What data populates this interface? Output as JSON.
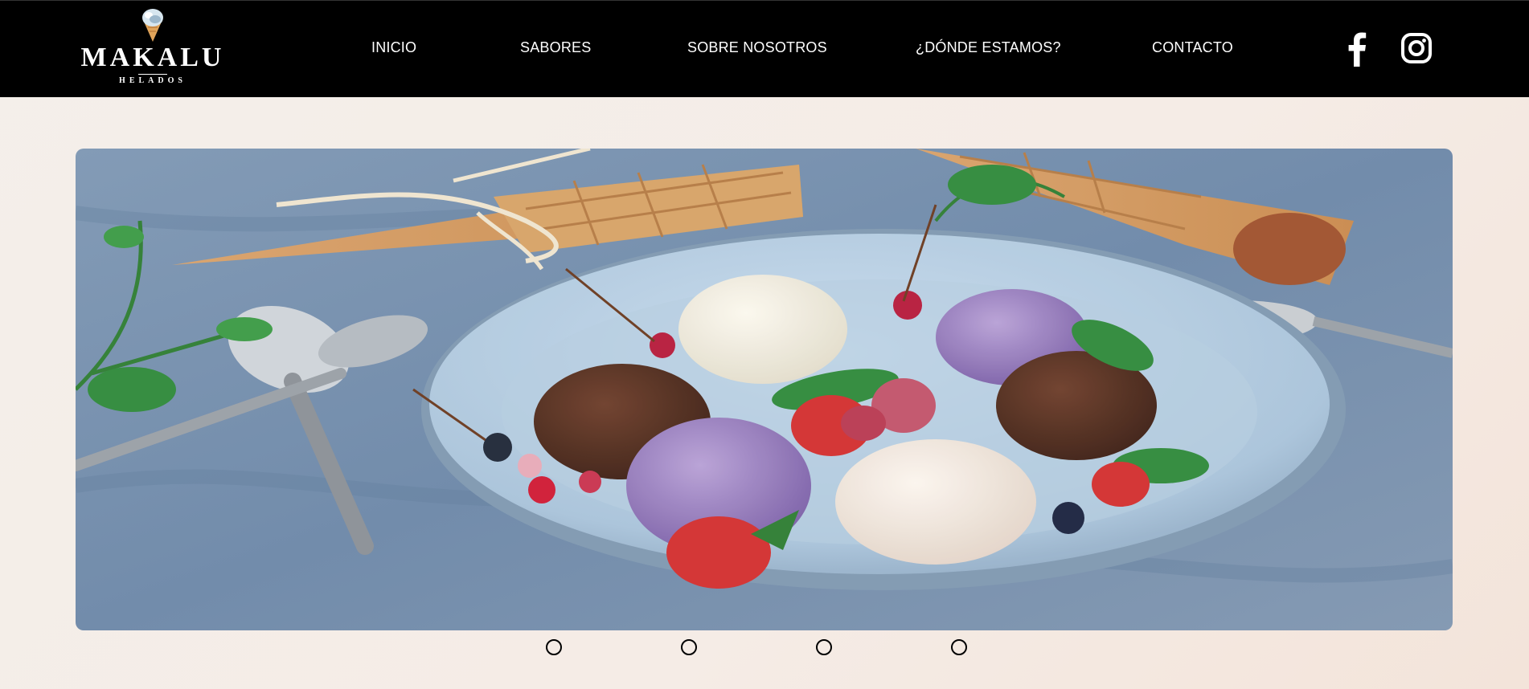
{
  "brand": {
    "name": "MAKALU",
    "tagline": "HELADOS",
    "logo_icon": "ice-cream-cone-icon"
  },
  "nav": {
    "items": [
      {
        "label": "INICIO"
      },
      {
        "label": "SABORES"
      },
      {
        "label": "SOBRE NOSOTROS"
      },
      {
        "label": "¿DÓNDE ESTAMOS?"
      },
      {
        "label": "CONTACTO"
      }
    ]
  },
  "social": {
    "facebook_icon": "facebook-icon",
    "instagram_icon": "instagram-icon"
  },
  "slideshow": {
    "slide_count": 4,
    "current_slide": 1,
    "hero_image": "ice-cream-scoops-plate-photo"
  },
  "colors": {
    "header_bg": "#000000",
    "page_bg": "#f4eee9",
    "nav_text": "#ffffff",
    "dot_border": "#000000"
  }
}
